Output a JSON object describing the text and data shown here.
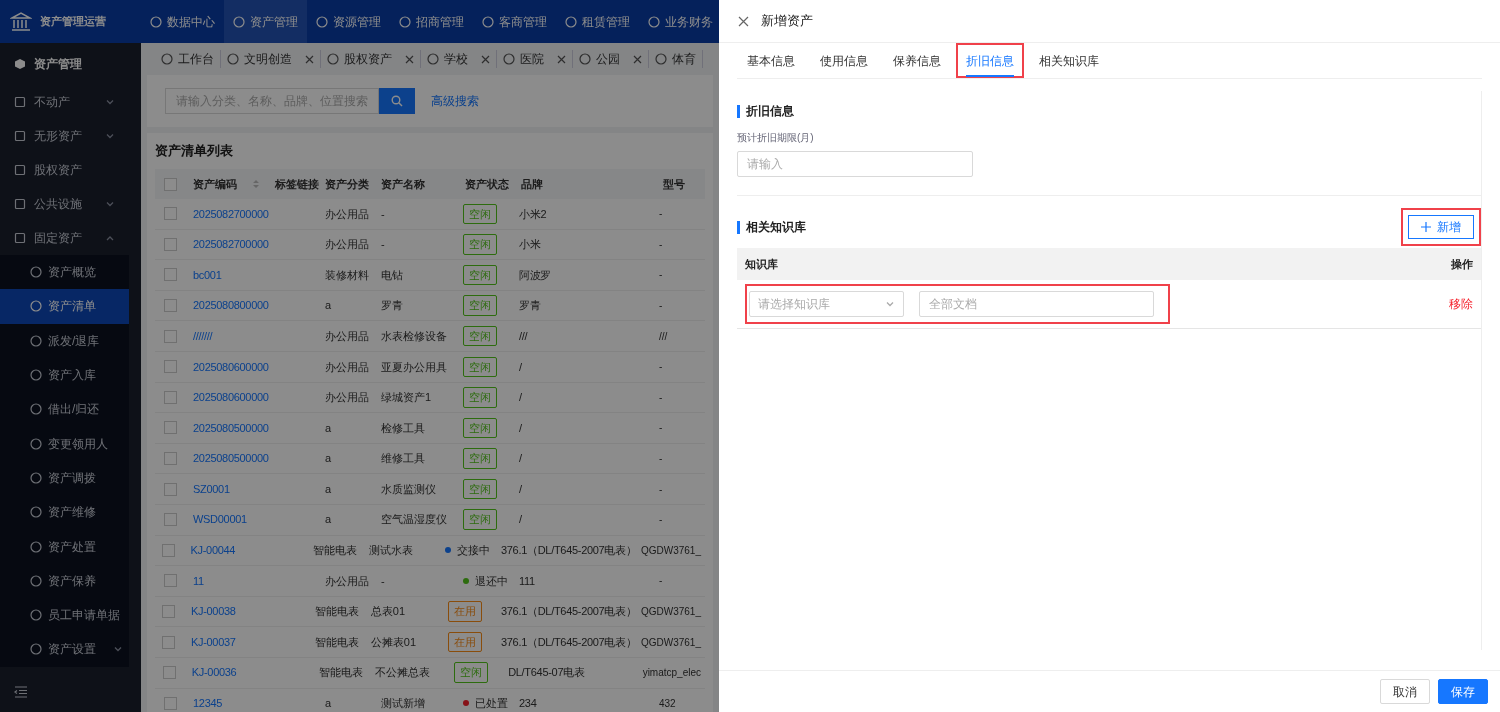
{
  "app": {
    "title": "资产管理运营"
  },
  "top_nav": [
    {
      "label": "数据中心",
      "selected": false
    },
    {
      "label": "资产管理",
      "selected": true
    },
    {
      "label": "资源管理",
      "selected": false
    },
    {
      "label": "招商管理",
      "selected": false
    },
    {
      "label": "客商管理",
      "selected": false
    },
    {
      "label": "租赁管理",
      "selected": false
    },
    {
      "label": "业务财务",
      "selected": false
    }
  ],
  "sidebar": {
    "title": "资产管理",
    "items": [
      {
        "label": "不动产",
        "expanded": false
      },
      {
        "label": "无形资产",
        "expanded": false
      },
      {
        "label": "股权资产"
      },
      {
        "label": "公共设施",
        "expanded": false
      },
      {
        "label": "固定资产",
        "expanded": true,
        "children": [
          {
            "label": "资产概览",
            "selected": false
          },
          {
            "label": "资产清单",
            "selected": true
          },
          {
            "label": "派发/退库",
            "selected": false
          },
          {
            "label": "资产入库",
            "selected": false
          },
          {
            "label": "借出/归还",
            "selected": false
          },
          {
            "label": "变更领用人",
            "selected": false
          },
          {
            "label": "资产调拨",
            "selected": false
          },
          {
            "label": "资产维修",
            "selected": false
          },
          {
            "label": "资产处置",
            "selected": false
          },
          {
            "label": "资产保养",
            "selected": false
          },
          {
            "label": "员工申请单据",
            "selected": false
          },
          {
            "label": "资产设置",
            "selected": false,
            "expanded": false
          }
        ]
      }
    ]
  },
  "tabs": [
    {
      "label": "工作台",
      "closable": false
    },
    {
      "label": "文明创造",
      "closable": true
    },
    {
      "label": "股权资产",
      "closable": true
    },
    {
      "label": "学校",
      "closable": true
    },
    {
      "label": "医院",
      "closable": true
    },
    {
      "label": "公园",
      "closable": true
    },
    {
      "label": "体育",
      "closable": false
    }
  ],
  "search": {
    "placeholder": "请输入分类、名称、品牌、位置搜索",
    "advanced": "高级搜索"
  },
  "table": {
    "title": "资产清单列表",
    "select_all": false,
    "columns": [
      "资产编码",
      "标签链接",
      "资产分类",
      "资产名称",
      "资产状态",
      "品牌",
      "型号"
    ],
    "rows": [
      {
        "checked": false,
        "code": "2025082700000",
        "category": "办公用品",
        "name": "-",
        "status": {
          "label": "空闲",
          "kind": "tag",
          "color": "#2d6c0e"
        },
        "brand": "小米2",
        "model": "-"
      },
      {
        "checked": false,
        "code": "2025082700000",
        "category": "办公用品",
        "name": "-",
        "status": {
          "label": "空闲",
          "kind": "tag",
          "color": "#2d6c0e"
        },
        "brand": "小米",
        "model": "-"
      },
      {
        "checked": false,
        "code": "bc001",
        "category": "装修材料",
        "name": "电钻",
        "status": {
          "label": "空闲",
          "kind": "tag",
          "color": "#2d6c0e"
        },
        "brand": "阿波罗",
        "model": "-"
      },
      {
        "checked": false,
        "code": "2025080800000",
        "category": "a",
        "name": "罗青",
        "status": {
          "label": "空闲",
          "kind": "tag",
          "color": "#2d6c0e"
        },
        "brand": "罗青",
        "model": "-"
      },
      {
        "checked": false,
        "code": "///////",
        "category": "办公用品",
        "name": "水表检修设备",
        "status": {
          "label": "空闲",
          "kind": "tag",
          "color": "#2d6c0e"
        },
        "brand": "///",
        "model": "///"
      },
      {
        "checked": false,
        "code": "2025080600000",
        "category": "办公用品",
        "name": "亚夏办公用具",
        "status": {
          "label": "空闲",
          "kind": "tag",
          "color": "#2d6c0e"
        },
        "brand": "/",
        "model": "-"
      },
      {
        "checked": false,
        "code": "2025080600000",
        "category": "办公用品",
        "name": "绿城资产1",
        "status": {
          "label": "空闲",
          "kind": "tag",
          "color": "#2d6c0e"
        },
        "brand": "/",
        "model": "-"
      },
      {
        "checked": false,
        "code": "2025080500000",
        "category": "a",
        "name": "检修工具",
        "status": {
          "label": "空闲",
          "kind": "tag",
          "color": "#2d6c0e"
        },
        "brand": "/",
        "model": "-"
      },
      {
        "checked": false,
        "code": "2025080500000",
        "category": "a",
        "name": "维修工具",
        "status": {
          "label": "空闲",
          "kind": "tag",
          "color": "#2d6c0e"
        },
        "brand": "/",
        "model": "-"
      },
      {
        "checked": false,
        "code": "SZ0001",
        "category": "a",
        "name": "水质监测仪",
        "status": {
          "label": "空闲",
          "kind": "tag",
          "color": "#2d6c0e"
        },
        "brand": "/",
        "model": "-"
      },
      {
        "checked": false,
        "code": "WSD00001",
        "category": "a",
        "name": "空气温湿度仪",
        "status": {
          "label": "空闲",
          "kind": "tag",
          "color": "#2d6c0e"
        },
        "brand": "/",
        "model": "-"
      },
      {
        "checked": false,
        "code": "KJ-00044",
        "category": "智能电表",
        "name": "测试水表",
        "status": {
          "label": "交接中",
          "kind": "dot",
          "color": "#0c418c"
        },
        "brand": "376.1（DL/T645-2007电表）",
        "model": "QGDW3761_"
      },
      {
        "checked": false,
        "code": "11",
        "category": "办公用品",
        "name": "-",
        "status": {
          "label": "退还中",
          "kind": "dot",
          "color": "#2d6c0e"
        },
        "brand": "111",
        "model": "-"
      },
      {
        "checked": false,
        "code": "KJ-00038",
        "category": "智能电表",
        "name": "总表01",
        "status": {
          "label": "在用",
          "kind": "tag",
          "color": "#894d0c"
        },
        "brand": "376.1（DL/T645-2007电表）",
        "model": "QGDW3761_"
      },
      {
        "checked": false,
        "code": "KJ-00037",
        "category": "智能电表",
        "name": "公摊表01",
        "status": {
          "label": "在用",
          "kind": "tag",
          "color": "#894d0c"
        },
        "brand": "376.1（DL/T645-2007电表）",
        "model": "QGDW3761_"
      },
      {
        "checked": false,
        "code": "KJ-00036",
        "category": "智能电表",
        "name": "不公摊总表",
        "status": {
          "label": "空闲",
          "kind": "tag",
          "color": "#2d6c0e"
        },
        "brand": "DL/T645-07电表",
        "model": "yimatcp_elec"
      },
      {
        "checked": false,
        "code": "12345",
        "category": "a",
        "name": "测试新增",
        "status": {
          "label": "已处置",
          "kind": "dot",
          "color": "#871319"
        },
        "brand": "234",
        "model": "432"
      }
    ]
  },
  "drawer": {
    "title": "新增资产",
    "tabs": [
      {
        "label": "基本信息",
        "selected": false,
        "highlighted": false
      },
      {
        "label": "使用信息",
        "selected": false,
        "highlighted": false
      },
      {
        "label": "保养信息",
        "selected": false,
        "highlighted": false
      },
      {
        "label": "折旧信息",
        "selected": true,
        "highlighted": true
      },
      {
        "label": "相关知识库",
        "selected": false,
        "highlighted": false
      }
    ],
    "depreciation": {
      "title": "折旧信息",
      "field_label": "预计折旧期限(月)",
      "placeholder": "请输入"
    },
    "knowledge": {
      "title": "相关知识库",
      "add_button": {
        "label": "新增",
        "highlighted": true
      },
      "columns": [
        "知识库",
        "操作"
      ],
      "rows": [
        {
          "select_placeholder": "请选择知识库",
          "doc_placeholder": "全部文档",
          "action": "移除",
          "highlighted": true
        }
      ]
    },
    "buttons": [
      {
        "label": "取消",
        "kind": "default"
      },
      {
        "label": "保存",
        "kind": "primary"
      }
    ]
  }
}
